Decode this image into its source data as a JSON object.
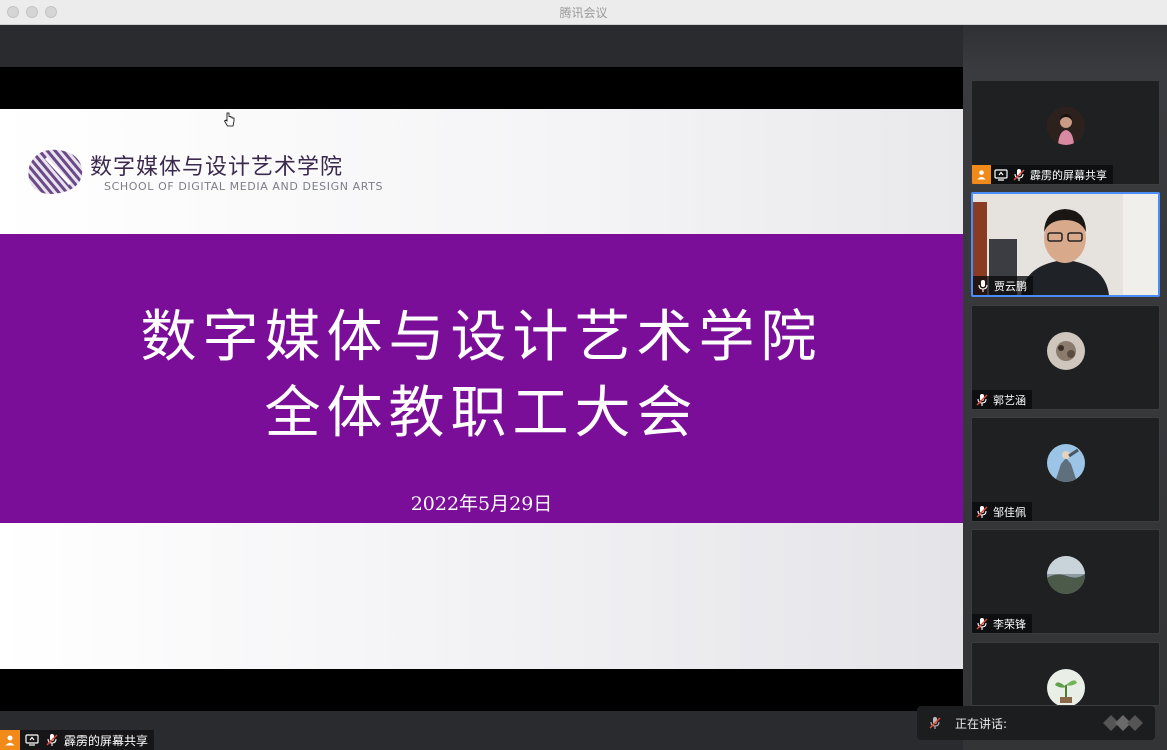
{
  "window": {
    "title": "腾讯会议"
  },
  "slide": {
    "logo_cn": "数字媒体与设计艺术学院",
    "logo_en": "SCHOOL OF DIGITAL MEDIA AND DESIGN ARTS",
    "title_line1": "数字媒体与设计艺术学院",
    "title_line2": "全体教职工大会",
    "date": "2022年5月29日",
    "band_color": "#7a0e99"
  },
  "presenter_tag": {
    "label": "霹雳的屏幕共享"
  },
  "participants": [
    {
      "name": "霹雳的屏幕共享",
      "type": "avatar",
      "icons": [
        "person-icon",
        "screen-share-icon",
        "mic-muted-icon"
      ]
    },
    {
      "name": "贾云鹏",
      "type": "video",
      "icons": [
        "mic-icon"
      ]
    },
    {
      "name": "郭艺涵",
      "type": "avatar",
      "icons": [
        "mic-muted-icon"
      ]
    },
    {
      "name": "邹佳佩",
      "type": "avatar",
      "icons": [
        "mic-muted-icon"
      ]
    },
    {
      "name": "李荣锋",
      "type": "avatar",
      "icons": [
        "mic-muted-icon"
      ]
    },
    {
      "name": "",
      "type": "avatar",
      "icons": []
    }
  ],
  "speaking": {
    "label": "正在讲话:"
  }
}
